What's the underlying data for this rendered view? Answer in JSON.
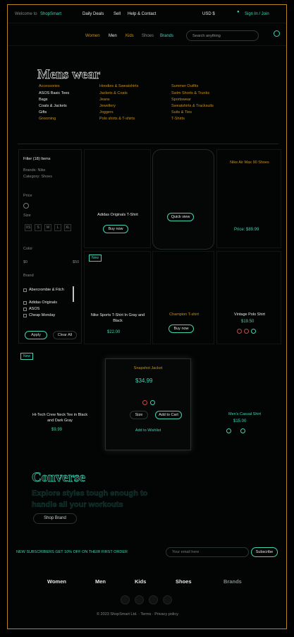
{
  "topbar": {
    "left_a": "Welcome to",
    "left_b": "ShopSmart",
    "promo_a": "Daily Deals",
    "promo_b": "Sell",
    "promo_c": "Help & Contact",
    "right_a": "USD $",
    "right_b": "Sign In / Join"
  },
  "nav": {
    "items": [
      "Women",
      "Men",
      "Kids",
      "Shoes",
      "Brands"
    ],
    "search_placeholder": "Search anything"
  },
  "hero": {
    "title": "Mens wear",
    "col1": [
      "Accessories",
      "ASOS Basic Tees",
      "Bags",
      "Coats & Jackets",
      "Gifts",
      "Grooming"
    ],
    "col2": [
      "Hoodies & Sweatshirts",
      "Jackets & Coats",
      "Jeans",
      "Jewellery",
      "Joggers",
      "Polo shirts & T-shirts"
    ],
    "col3": [
      "Summer Outfits",
      "Swim Shorts & Trunks",
      "Sportswear",
      "Sweatshirts & Tracksuits",
      "Suits & Ties",
      "T-Shirts"
    ]
  },
  "filter": {
    "title": "Filter (18) Items",
    "applied_a": "Brands: Nike",
    "applied_b": "Category: Shoes",
    "section_price": "Price",
    "section_size": "Size",
    "section_color": "Color",
    "section_brand": "Brand",
    "price_min": "$0",
    "price_max": "$50",
    "sizes": [
      "XS",
      "S",
      "M",
      "L",
      "XL"
    ],
    "brands": [
      "Abercrombie & Fitch",
      "Adidas Originals",
      "ASOS",
      "Cheap Monday"
    ],
    "apply": "Apply",
    "clear": "Clear All"
  },
  "products": [
    {
      "name": "Adidas Originals T-Shirt",
      "button": "Buy now"
    },
    {
      "name": "",
      "button": "Quick view"
    },
    {
      "name": "Nike Air Max 90 Shoes",
      "price": "Price: $89.99"
    },
    {
      "badge": "New"
    },
    {
      "name": "Nike Sports T-Shirt In Gray and Black",
      "price": "$22.00"
    },
    {
      "name": "Champion T-shirt",
      "button": "Buy now"
    },
    {
      "name": "Vintage Polo Shirt",
      "price": "$19.50"
    }
  ],
  "row3": {
    "badge": "New",
    "left_name": "Hi-Tech Crew Neck Tee in Black and Dark Gray",
    "left_price": "$9.99",
    "right_name": "Men's Casual Shirt",
    "right_price": "$15.00"
  },
  "popup": {
    "title": "Snapshot Jacket",
    "price": "$34.99",
    "size": "Size",
    "add": "Add to Cart",
    "wishlist": "Add to Wishlist"
  },
  "converse": {
    "title": "Converse",
    "subtitle": "Explore styles tough enough to handle all your workouts",
    "button": "Shop Brand"
  },
  "newsletter": {
    "text_a": "NEW SUBSCRIBERS GET 10% OFF ON THEIR FIRST ORDER",
    "email_placeholder": "Your email here",
    "subscribe": "Subscribe"
  },
  "footer": {
    "links": [
      "Women",
      "Men",
      "Kids",
      "Shoes",
      "Brands"
    ],
    "copyright": "© 2023 ShopSmart Ltd. · Terms · Privacy policy"
  },
  "colors": {
    "accent": "#3fd3b4",
    "gold": "#c7901d",
    "background": "#030504"
  }
}
